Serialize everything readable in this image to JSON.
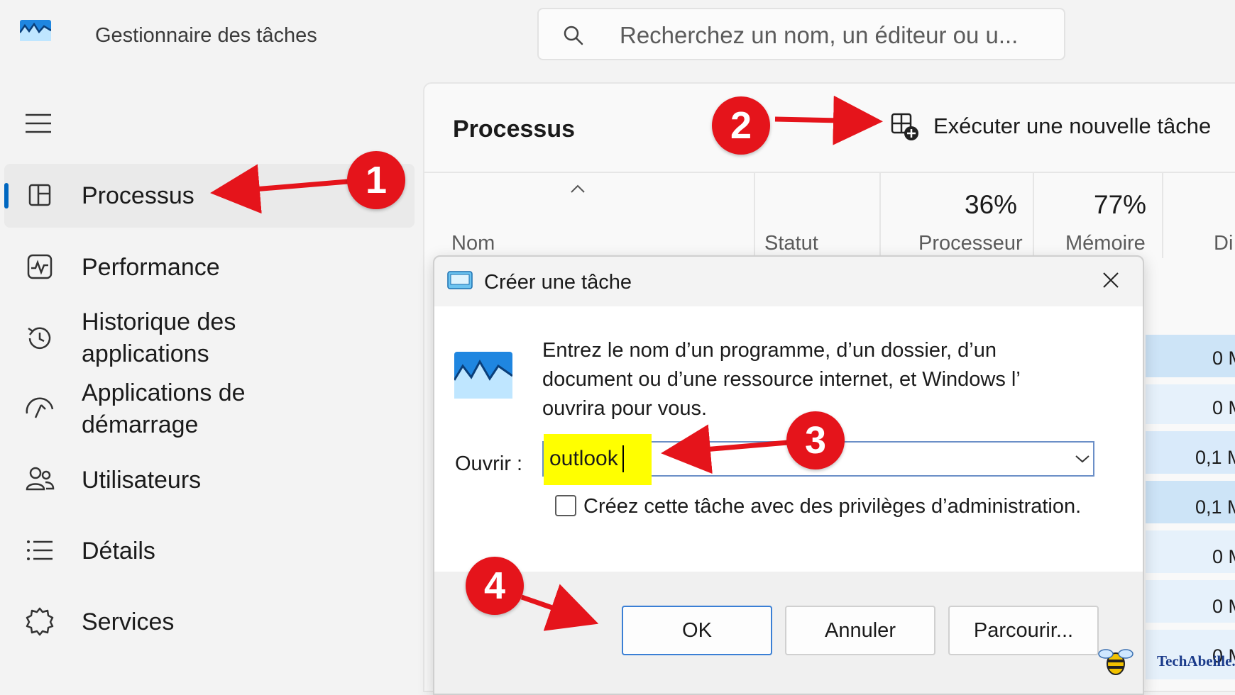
{
  "app": {
    "title": "Gestionnaire des tâches"
  },
  "search": {
    "placeholder": "Recherchez un nom, un éditeur ou u..."
  },
  "sidebar": {
    "items": [
      {
        "label": "Processus",
        "icon": "processes-icon",
        "active": true
      },
      {
        "label": "Performance",
        "icon": "performance-icon"
      },
      {
        "label_line1": "Historique des",
        "label_line2": "applications",
        "icon": "app-history-icon"
      },
      {
        "label_line1": "Applications de",
        "label_line2": "démarrage",
        "icon": "startup-apps-icon"
      },
      {
        "label": "Utilisateurs",
        "icon": "users-icon"
      },
      {
        "label": "Détails",
        "icon": "details-icon"
      },
      {
        "label": "Services",
        "icon": "services-icon"
      }
    ]
  },
  "content": {
    "title": "Processus",
    "new_task_label": "Exécuter une nouvelle tâche",
    "columns": {
      "name": "Nom",
      "status": "Statut",
      "cpu_pct": "36%",
      "cpu": "Processeur",
      "mem_pct": "77%",
      "mem": "Mémoire",
      "disk_partial": "Di"
    },
    "row_values": [
      "0 M",
      "0 M",
      "0,1 M",
      "0,1 M",
      "0 M",
      "0 M",
      "0 M"
    ]
  },
  "dialog": {
    "title": "Créer une tâche",
    "message": "Entrez le nom d’un programme, d’un dossier, d’un document ou d’une ressource internet, et Windows l’ ouvrira pour vous.",
    "open_label": "Ouvrir :",
    "open_value": "outlook",
    "admin_checkbox_label": "Créez cette tâche avec des privilèges d’administration.",
    "admin_checked": false,
    "ok": "OK",
    "cancel": "Annuler",
    "browse": "Parcourir..."
  },
  "annotations": {
    "badge1": "1",
    "badge2": "2",
    "badge3": "3",
    "badge4": "4",
    "color": "#e5141b"
  },
  "watermark": {
    "text": "TechAbeille.FR"
  },
  "colors": {
    "accent": "#0067c0",
    "highlight": "#ffff00",
    "row_highlight": "#cde4f7"
  }
}
